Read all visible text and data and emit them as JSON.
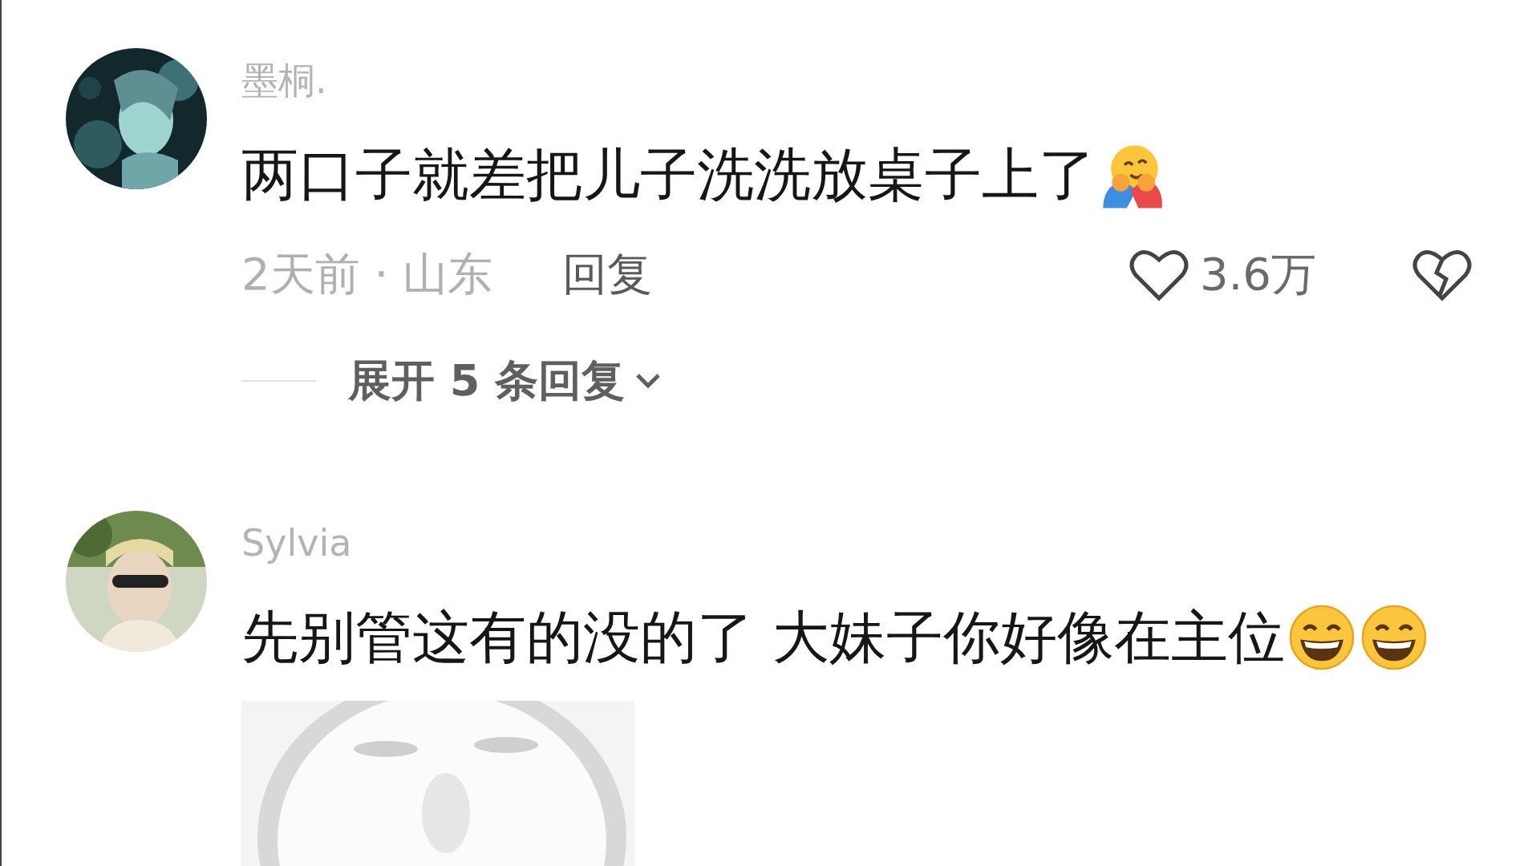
{
  "comments": [
    {
      "avatar": {
        "kind": "picture"
      },
      "username": "墨桐.",
      "text": "两口子就差把儿子洗洗放桌子上了",
      "emojis": [
        {
          "kind": "hug"
        }
      ],
      "time_location": "2天前 · 山东",
      "reply": "回复",
      "likes": "3.6万",
      "liked": false,
      "expand": "展开 5 条回复"
    },
    {
      "avatar": {
        "kind": "picture"
      },
      "username": "Sylvia",
      "text": "先别管这有的没的了 大妹子你好像在主位",
      "emojis": [
        {
          "kind": "grin"
        },
        {
          "kind": "grin"
        }
      ],
      "image": {
        "kind": "picture"
      }
    }
  ]
}
